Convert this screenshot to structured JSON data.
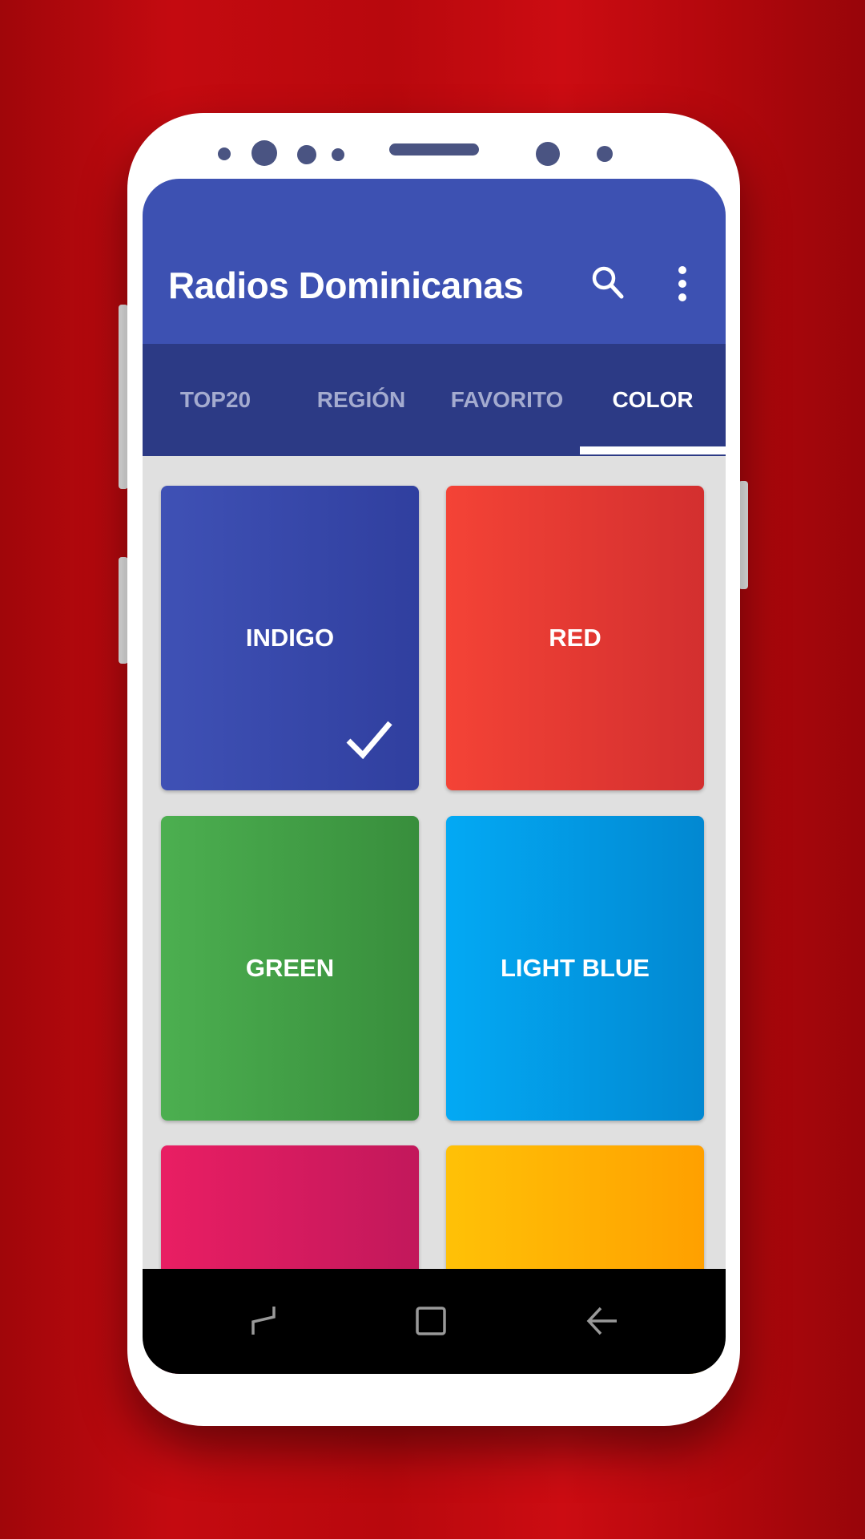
{
  "app": {
    "title": "Radios Dominicanas",
    "actions": [
      {
        "icon": "search-icon"
      },
      {
        "icon": "more-vert-icon"
      }
    ]
  },
  "tabs": [
    {
      "label": "TOP20",
      "active": false
    },
    {
      "label": "REGIÓN",
      "active": false
    },
    {
      "label": "FAVORITO",
      "active": false
    },
    {
      "label": "COLOR",
      "active": true
    }
  ],
  "colors": [
    {
      "label": "INDIGO",
      "from": "#3f51b5",
      "to": "#303f9f",
      "selected": true
    },
    {
      "label": "RED",
      "from": "#f44336",
      "to": "#d32f2f",
      "selected": false
    },
    {
      "label": "GREEN",
      "from": "#4caf50",
      "to": "#388e3c",
      "selected": false
    },
    {
      "label": "LIGHT BLUE",
      "from": "#03a9f4",
      "to": "#0288d1",
      "selected": false
    },
    {
      "label": "",
      "from": "#e91e63",
      "to": "#c2185b",
      "selected": false
    },
    {
      "label": "",
      "from": "#ffc107",
      "to": "#ffa000",
      "selected": false
    }
  ],
  "navbar": [
    {
      "icon": "recent-apps-icon"
    },
    {
      "icon": "home-icon"
    },
    {
      "icon": "back-icon"
    }
  ],
  "accent": {
    "primary": "#3d51b2",
    "tabbar": "#2c3a85",
    "background": "#c40a10"
  }
}
